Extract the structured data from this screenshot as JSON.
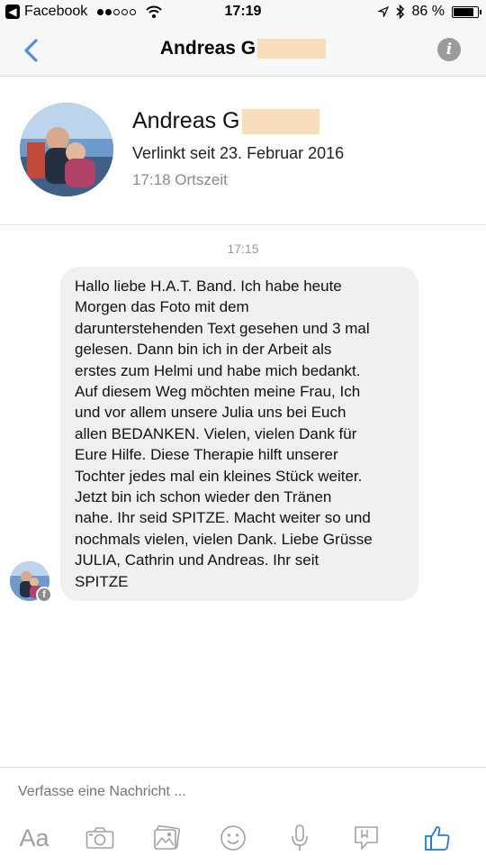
{
  "status_bar": {
    "back_app": "Facebook",
    "time": "17:19",
    "battery_percent": "86 %",
    "battery_level": 0.86
  },
  "header": {
    "title": "Andreas G",
    "back_icon": "chevron-left-icon",
    "info_icon": "info-icon"
  },
  "profile": {
    "name": "Andreas G",
    "linked_since": "Verlinkt seit 23. Februar 2016",
    "local_time": "17:18 Ortszeit"
  },
  "chat": {
    "timestamp": "17:15",
    "message": "Hallo liebe H.A.T. Band. Ich habe heute\nMorgen das Foto mit dem\ndarunterstehenden Text gesehen und 3 mal\ngelesen. Dann bin ich in der Arbeit als\nerstes zum Helmi und habe mich bedankt.\nAuf diesem Weg möchten meine Frau, Ich\nund vor allem unsere Julia uns bei Euch\nallen BEDANKEN. Vielen, vielen Dank für\nEure Hilfe. Diese Therapie hilft unserer\nTochter jedes mal ein kleines Stück weiter.\nJetzt bin ich schon wieder den Tränen\nnahe. Ihr seid SPITZE. Macht weiter so und\nnochmals vielen, vielen Dank. Liebe Grüsse\nJULIA, Cathrin und Andreas. Ihr seit\nSPITZE"
  },
  "composer": {
    "placeholder": "Verfasse eine Nachricht ...",
    "tools": [
      "Aa",
      "camera-icon",
      "image-icon",
      "emoji-icon",
      "microphone-icon",
      "sticker-icon",
      "thumbs-up-icon"
    ]
  },
  "colors": {
    "accent": "#4a90e2",
    "like": "#1f7ae0",
    "bubble": "#f0f0f0",
    "redaction": "#f7ddb9"
  }
}
